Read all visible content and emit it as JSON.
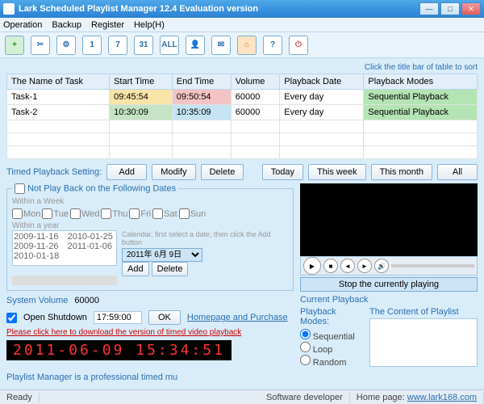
{
  "window": {
    "title": "Lark Scheduled Playlist Manager  12.4 Evaluation version"
  },
  "menu": {
    "operation": "Operation",
    "backup": "Backup",
    "register": "Register",
    "help": "Help(H)"
  },
  "toolbar": {
    "i1": "+",
    "i2": "✂",
    "i3": "⚙",
    "i4": "1",
    "i5": "7",
    "i6": "31",
    "i7": "ALL",
    "i8": "👤",
    "i9": "✉",
    "i10": "⌂",
    "i11": "?",
    "i12": "⏻"
  },
  "sorthint": "Click the title bar of table to sort",
  "cols": {
    "name": "The Name of Task",
    "start": "Start Time",
    "end": "End Time",
    "vol": "Volume",
    "pdate": "Playback Date",
    "pmode": "Playback Modes"
  },
  "tasks": [
    {
      "name": "Task-1",
      "start": "09:45:54",
      "end": "09:50:54",
      "vol": "60000",
      "pdate": "Every day",
      "pmode": "Sequential Playback"
    },
    {
      "name": "Task-2",
      "start": "10:30:09",
      "end": "10:35:09",
      "vol": "60000",
      "pdate": "Every day",
      "pmode": "Sequential Playback"
    }
  ],
  "labels": {
    "tps": "Timed Playback Setting:",
    "add": "Add",
    "modify": "Modify",
    "delete": "Delete",
    "today": "Today",
    "week": "This week",
    "month": "This month",
    "all": "All",
    "notplay": "Not Play Back on the Following Dates",
    "withinweek": "Within a Week",
    "mon": "Mon",
    "tue": "Tue",
    "wed": "Wed",
    "thu": "Thu",
    "fri": "Fri",
    "sat": "Sat",
    "sun": "Sun",
    "withinyear": "Within a year",
    "calnote": "Calendar, first select a date, then click the Add button",
    "calval": "2011年 6月 9日",
    "sysvol": "System Volume",
    "sysvolval": "60000",
    "openshut": "Open Shutdown",
    "shuttime": "17:59:00",
    "ok": "OK",
    "homepage": "Homepage and Purchase",
    "dl": "Please click here to download the version of timed video playback",
    "clock": "2011-06-09 15:34:51",
    "stop": "Stop the currently playing",
    "curpb": "Current Playback",
    "pbmodes": "Playback Modes:",
    "seq": "Sequential",
    "loop": "Loop",
    "rand": "Random",
    "plcontent": "The Content of Playlist",
    "marquee": "Playlist Manager  is a professional timed mu"
  },
  "dates": {
    "d1": "2009-11-16",
    "d2": "2010-01-25",
    "d3": "2009-11-26",
    "d4": "2011-01-06",
    "d5": "2010-01-18"
  },
  "status": {
    "ready": "Ready",
    "dev": "Software developer",
    "home": "Home page:",
    "url": "www.lark168.com"
  }
}
